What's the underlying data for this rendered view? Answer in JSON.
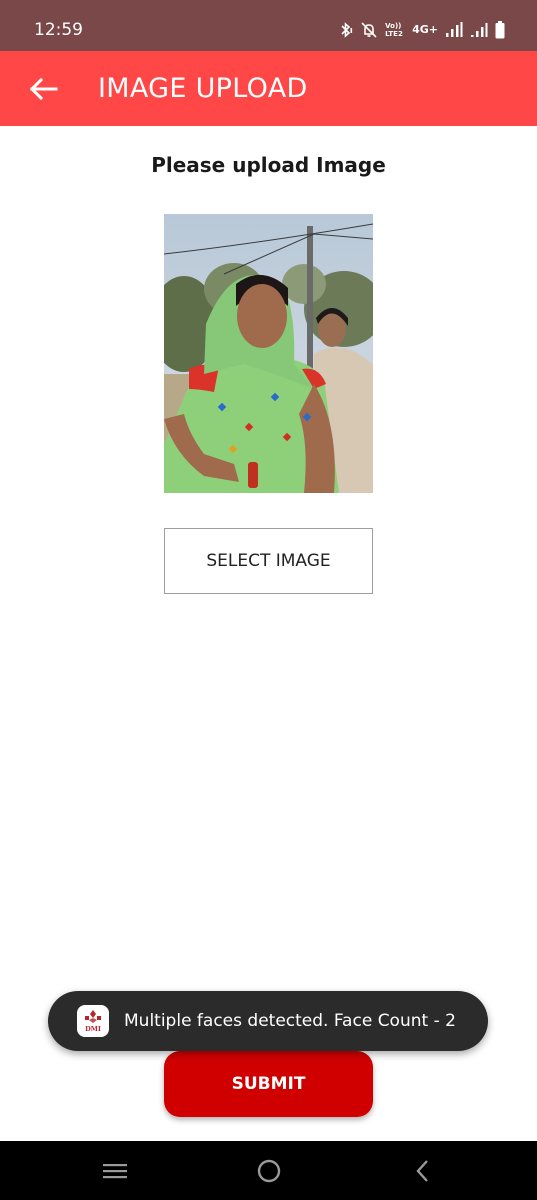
{
  "status_bar": {
    "time": "12:59",
    "network_label": "4G+",
    "volte_label": "Vo)) LTE2",
    "icons": [
      "bluetooth-icon",
      "mute-icon",
      "volte-icon",
      "signal-icon",
      "signal-icon",
      "battery-icon"
    ]
  },
  "app_bar": {
    "title": "IMAGE UPLOAD",
    "back_icon": "arrow-left-icon",
    "color": "#ff4747"
  },
  "main": {
    "heading": "Please upload Image",
    "select_button_label": "SELECT IMAGE",
    "submit_button_label": "SUBMIT"
  },
  "toast": {
    "message": "Multiple faces detected. Face Count - 2",
    "logo_text": "DMI"
  },
  "nav_bar": {
    "icons": [
      "recent-apps-icon",
      "home-icon",
      "back-icon"
    ]
  },
  "colors": {
    "status_bar": "#7a4848",
    "app_bar": "#ff4747",
    "submit": "#d10000",
    "toast": "#2b2b2b"
  }
}
